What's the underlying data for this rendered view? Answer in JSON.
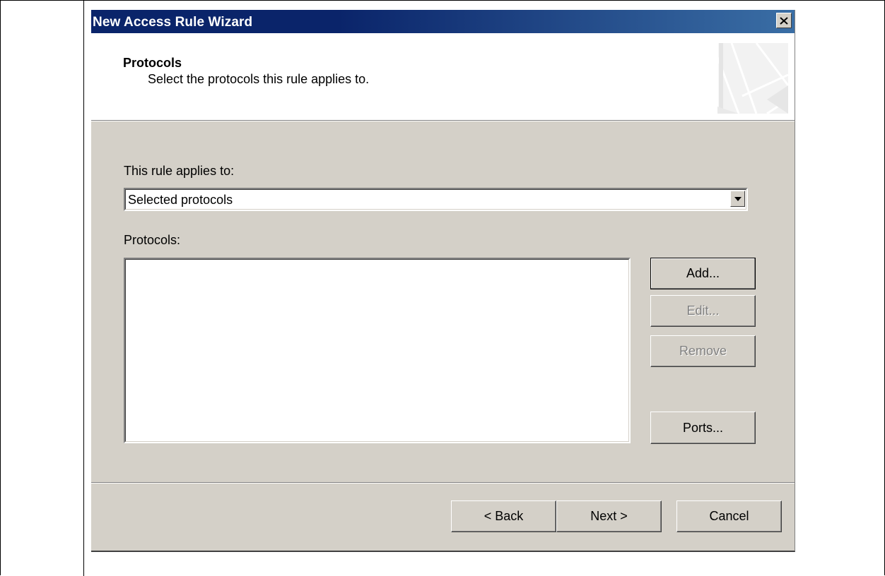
{
  "window": {
    "title": "New Access Rule Wizard"
  },
  "header": {
    "title": "Protocols",
    "subtitle": "Select the protocols this rule applies to."
  },
  "form": {
    "applies_label": "This rule applies to:",
    "applies_value": "Selected protocols",
    "protocols_label": "Protocols:",
    "protocols": []
  },
  "side_buttons": {
    "add": "Add...",
    "edit": "Edit...",
    "remove": "Remove",
    "ports": "Ports..."
  },
  "footer": {
    "back": "< Back",
    "next": "Next >",
    "cancel": "Cancel"
  },
  "icons": {
    "close": "close-icon",
    "dropdown": "chevron-down-icon",
    "header_graphic": "wizard-graphic"
  },
  "colors": {
    "title_bar": "#0a246a",
    "dialog_bg": "#d4d0c8",
    "header_bg": "#ffffff"
  }
}
